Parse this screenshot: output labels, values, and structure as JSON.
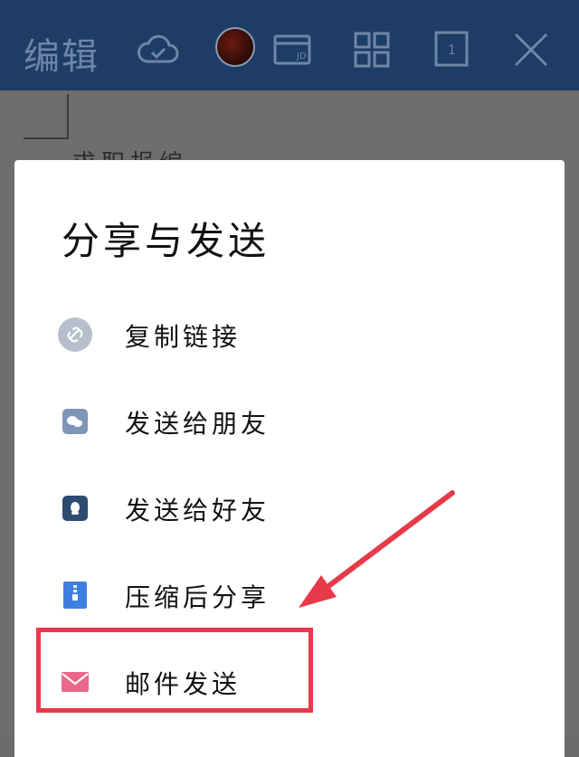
{
  "toolbar": {
    "title": "编辑",
    "icons": [
      "cloud-check-icon",
      "avatar",
      "jd-card-icon",
      "grid-icon",
      "page-count-icon",
      "close-icon"
    ],
    "page_count": "1",
    "jd_label": "JD",
    "bg_color": "#1d3c66"
  },
  "background": {
    "partial_text": "求职报编"
  },
  "share_sheet": {
    "title": "分享与发送",
    "items": [
      {
        "label": "复制链接",
        "icon": "link-icon",
        "color": "#b7bfcc"
      },
      {
        "label": "发送给朋友",
        "icon": "wechat-icon",
        "color": "#7f95b8"
      },
      {
        "label": "发送给好友",
        "icon": "qq-icon",
        "color": "#2d4b6f"
      },
      {
        "label": "压缩后分享",
        "icon": "zip-icon",
        "color": "#3e7ee0"
      },
      {
        "label": "邮件发送",
        "icon": "mail-icon",
        "color": "#e8678a"
      }
    ]
  },
  "annotation": {
    "highlight_color": "#e63a4a"
  }
}
